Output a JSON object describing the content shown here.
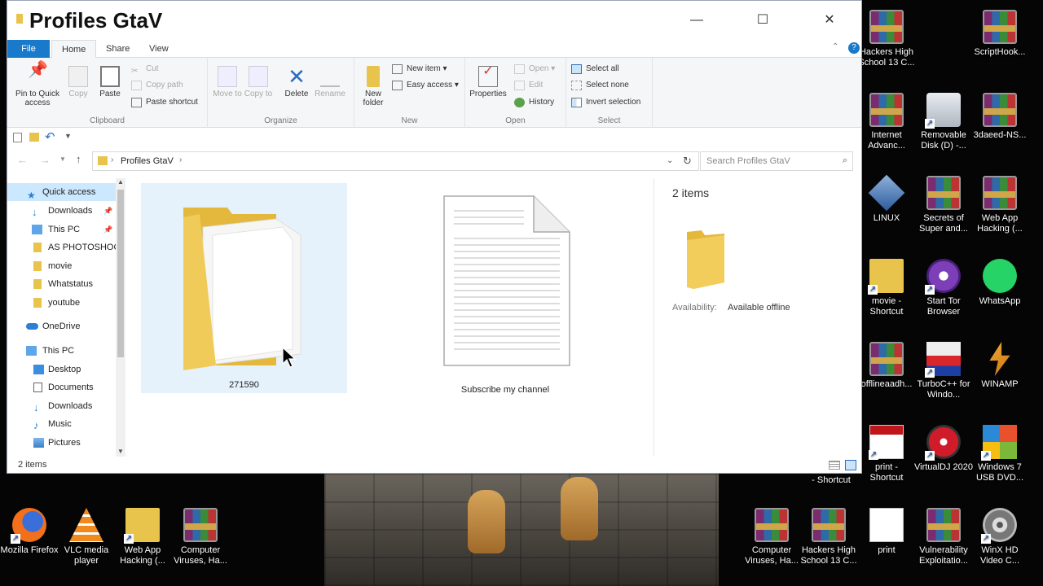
{
  "window": {
    "title": "Profiles GtaV",
    "minimize": "—",
    "maximize": "☐",
    "close": "✕"
  },
  "ribbon_tabs": [
    "File",
    "Home",
    "Share",
    "View"
  ],
  "ribbon": {
    "clipboard": {
      "label": "Clipboard",
      "pin": "Pin to Quick access",
      "copy": "Copy",
      "paste": "Paste",
      "cut": "Cut",
      "copy_path": "Copy path",
      "paste_shortcut": "Paste shortcut"
    },
    "organize": {
      "label": "Organize",
      "move_to": "Move to",
      "copy_to": "Copy to",
      "delete": "Delete",
      "rename": "Rename"
    },
    "new": {
      "label": "New",
      "new_folder": "New folder",
      "new_item": "New item",
      "easy_access": "Easy access"
    },
    "open": {
      "label": "Open",
      "properties": "Properties",
      "open": "Open",
      "edit": "Edit",
      "history": "History"
    },
    "select": {
      "label": "Select",
      "select_all": "Select all",
      "select_none": "Select none",
      "invert": "Invert selection"
    }
  },
  "address": {
    "path": "Profiles GtaV",
    "search_placeholder": "Search Profiles GtaV"
  },
  "nav": {
    "quick_access": "Quick access",
    "items": [
      "Downloads",
      "This PC",
      "AS PHOTOSHOC",
      "movie",
      "Whatstatus",
      "youtube"
    ],
    "onedrive": "OneDrive",
    "this_pc": "This PC",
    "pc_items": [
      "Desktop",
      "Documents",
      "Downloads",
      "Music",
      "Pictures"
    ]
  },
  "files": [
    {
      "name": "271590",
      "type": "folder"
    },
    {
      "name": "Subscribe my channel",
      "type": "text"
    }
  ],
  "preview": {
    "count": "2 items",
    "availability_label": "Availability:",
    "availability_value": "Available offline"
  },
  "status": {
    "count": "2 items"
  },
  "desktop_right": [
    {
      "label": "Hackers High School 13 C..."
    },
    {
      "label": "ScriptHook..."
    },
    {
      "label": "Internet Advanc..."
    },
    {
      "label": "Removable Disk (D) -..."
    },
    {
      "label": "3daeed-NS..."
    },
    {
      "label": "LINUX"
    },
    {
      "label": "Secrets of Super and..."
    },
    {
      "label": "Web App Hacking (..."
    },
    {
      "label": "movie - Shortcut"
    },
    {
      "label": "Start Tor Browser"
    },
    {
      "label": "WhatsApp"
    },
    {
      "label": "offlineaadh..."
    },
    {
      "label": "TurboC++ for Windo..."
    },
    {
      "label": "WINAMP"
    },
    {
      "label": "- Shortcut"
    },
    {
      "label": "print - Shortcut"
    },
    {
      "label": "VirtualDJ 2020"
    },
    {
      "label": "Windows 7 USB DVD..."
    }
  ],
  "desktop_bottom": [
    {
      "label": "Mozilla Firefox"
    },
    {
      "label": "VLC media player"
    },
    {
      "label": "Web App Hacking (..."
    },
    {
      "label": "Computer Viruses, Ha..."
    },
    {
      "label": "Computer Viruses, Ha..."
    },
    {
      "label": "Hackers High School 13 C..."
    },
    {
      "label": "print"
    },
    {
      "label": "Vulnerability Exploitatio..."
    },
    {
      "label": "WinX HD Video C..."
    }
  ]
}
